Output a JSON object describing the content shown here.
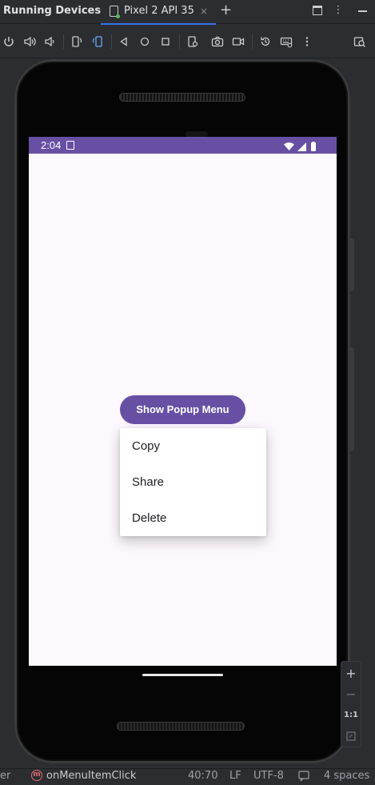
{
  "window": {
    "panel_title": "Running Devices",
    "tab_label": "Pixel 2 API 35",
    "tab_close": "×",
    "add_tab": "+",
    "more": "⋮"
  },
  "device": {
    "status_time": "2:04",
    "button_label": "Show Popup Menu",
    "menu_items": [
      "Copy",
      "Share",
      "Delete"
    ],
    "accent_color": "#6750a4",
    "screen_background": "#fdf7fe"
  },
  "zoom": {
    "zoom_in": "+",
    "zoom_out": "−",
    "actual_size": "1:1"
  },
  "status_bar": {
    "truncated_left": "er",
    "method_badge": "m",
    "method_name": "onMenuItemClick",
    "cursor_position": "40:70",
    "line_separator": "LF",
    "encoding": "UTF-8",
    "indent": "4 spaces"
  },
  "icons": [
    "power-icon",
    "volume-up-icon",
    "volume-down-icon",
    "rotate-left-icon",
    "rotate-right-icon",
    "back-icon",
    "home-icon",
    "overview-icon",
    "device-settings-icon",
    "screenshot-icon",
    "screen-record-icon",
    "reset-icon",
    "keyboard-icon",
    "more-icon",
    "device-explorer-icon"
  ]
}
